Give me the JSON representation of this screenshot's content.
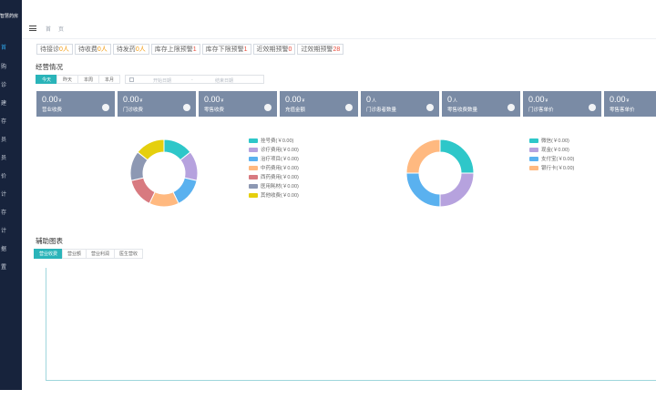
{
  "sidebar": {
    "logo": "智慧药房",
    "items": [
      "首",
      "购",
      "诊",
      "建",
      "存",
      "员",
      "员",
      "价",
      "计",
      "存",
      "计",
      "据",
      "置"
    ]
  },
  "header": {
    "home": "首页"
  },
  "alerts": [
    {
      "label": "待接诊",
      "count": "0人",
      "color": "#f39c12"
    },
    {
      "label": "待收费",
      "count": "0人",
      "color": "#f39c12"
    },
    {
      "label": "待发药",
      "count": "0人",
      "color": "#f39c12"
    },
    {
      "label": "库存上限预警",
      "count": "1",
      "color": "#e74c3c"
    },
    {
      "label": "库存下限预警",
      "count": "1",
      "color": "#e74c3c"
    },
    {
      "label": "近效期预警",
      "count": "0",
      "color": "#e74c3c"
    },
    {
      "label": "过效期预警",
      "count": "28",
      "color": "#e74c3c"
    }
  ],
  "overview": {
    "title": "经营情况",
    "date_tabs": [
      "今天",
      "昨天",
      "本周",
      "本月"
    ],
    "range_start": "开始日期",
    "range_sep": "-",
    "range_end": "结束日期"
  },
  "cards": [
    {
      "value": "0.00",
      "unit": "¥",
      "label": "营业收费"
    },
    {
      "value": "0.00",
      "unit": "¥",
      "label": "门诊收费"
    },
    {
      "value": "0.00",
      "unit": "¥",
      "label": "零售收费"
    },
    {
      "value": "0.00",
      "unit": "¥",
      "label": "充值金额"
    },
    {
      "value": "0",
      "unit": "人",
      "label": "门诊患者数量"
    },
    {
      "value": "0",
      "unit": "人",
      "label": "零售收费数量"
    },
    {
      "value": "0.00",
      "unit": "¥",
      "label": "门诊客单价"
    },
    {
      "value": "0.00",
      "unit": "¥",
      "label": "零售客单价"
    }
  ],
  "donut_left": {
    "legend": [
      {
        "label": "挂号费(￥0.00)",
        "color": "#2ec7c9"
      },
      {
        "label": "诊疗费用(￥0.00)",
        "color": "#b6a2de"
      },
      {
        "label": "治疗项目(￥0.00)",
        "color": "#5ab1ef"
      },
      {
        "label": "中药费用(￥0.00)",
        "color": "#ffb980"
      },
      {
        "label": "西药费用(￥0.00)",
        "color": "#d87a80"
      },
      {
        "label": "医用耗材(￥0.00)",
        "color": "#8d98b3"
      },
      {
        "label": "其他收费(￥0.00)",
        "color": "#e5cf0d"
      }
    ]
  },
  "donut_right": {
    "legend": [
      {
        "label": "微信(￥0.00)",
        "color": "#2ec7c9"
      },
      {
        "label": "现金(￥0.00)",
        "color": "#b6a2de"
      },
      {
        "label": "支付宝(￥0.00)",
        "color": "#5ab1ef"
      },
      {
        "label": "银行卡(￥0.00)",
        "color": "#ffb980"
      }
    ]
  },
  "aux": {
    "title": "辅助图表",
    "tabs": [
      "营业收费",
      "营业额",
      "营业利润",
      "医生营收"
    ]
  }
}
